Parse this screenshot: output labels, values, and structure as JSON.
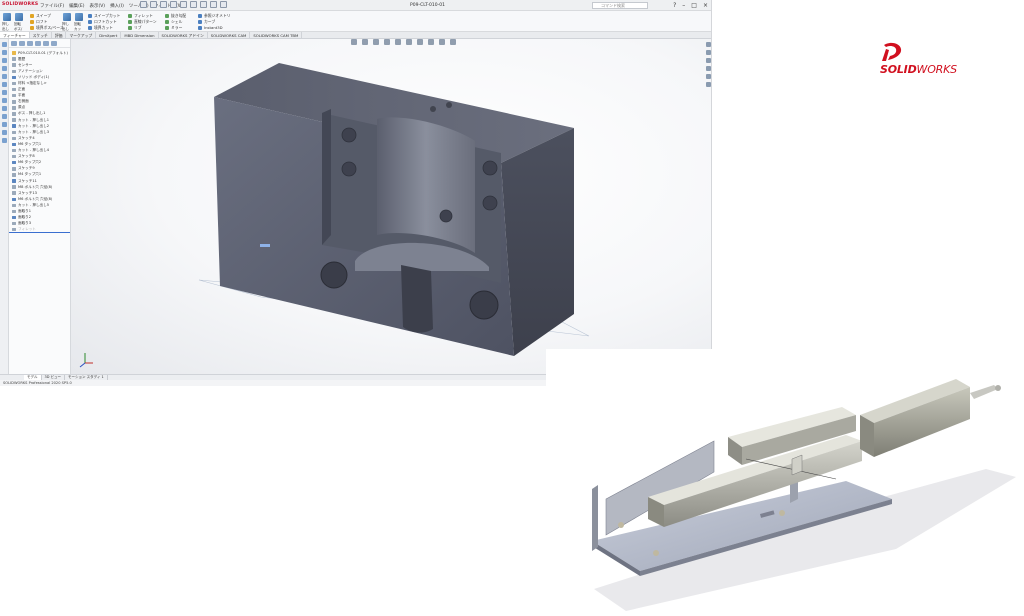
{
  "app": {
    "logo_text": "SOLIDWORKS",
    "document_title": "P09-CLT-010-01",
    "menus": [
      "ファイル(F)",
      "編集(E)",
      "表示(V)",
      "挿入(I)",
      "ツール(T)",
      "ウィンドウ(W)"
    ],
    "search_placeholder": "コマンド検索",
    "window_controls": [
      "?",
      "–",
      "□",
      "×"
    ]
  },
  "ribbon": {
    "groups": [
      {
        "items": [
          "押し出し ボス/ベース",
          "回転 ボス/ベース"
        ]
      },
      {
        "items": [
          "スイープ",
          "ロフト",
          "境界ボス/ベース"
        ]
      },
      {
        "items": [
          "押し出しカット",
          "回転カット"
        ]
      },
      {
        "items": [
          "スイープカット",
          "ロフトカット",
          "境界カット"
        ]
      },
      {
        "items": [
          "フィレット",
          "直線パターン",
          "リブ"
        ]
      },
      {
        "items": [
          "抜き勾配",
          "シェル",
          "ミラー"
        ]
      },
      {
        "items": [
          "参照ジオメトリ",
          "カーブ",
          "Instant3D"
        ]
      }
    ]
  },
  "command_tabs": [
    "フィーチャー",
    "スケッチ",
    "評価",
    "マークアップ",
    "DimXpert",
    "MBD Dimension",
    "SOLIDWORKS アドイン",
    "SOLIDWORKS CAM",
    "SOLIDWORKS CAM TBM"
  ],
  "feature_tree": [
    "P09-CLT-010-01 (デフォルト)",
    "履歴",
    "センサー",
    "アノテーション",
    "ソリッド ボディ(1)",
    "材料 <指定なし>",
    "正面",
    "平面",
    "右側面",
    "原点",
    "ボス - 押し出し1",
    "カット - 押し出し1",
    "カット - 押し出し2",
    "カット - 押し出し3",
    "スケッチ4",
    "M6 タップ穴1",
    "カット - 押し出し4",
    "スケッチ8",
    "M6 タップ穴2",
    "スケッチ9",
    "M4 タップ穴1",
    "スケッチ11",
    "M8 ボルト穴 穴径(8)",
    "スケッチ13",
    "M6 ボルト穴 穴径(8)",
    "カット - 押し出し5",
    "面取り1",
    "面取り2",
    "面取り3",
    "フィレット"
  ],
  "bottom_tabs": [
    "モデル",
    "3D ビュー",
    "モーション スタディ 1"
  ],
  "status_text": "SOLIDWORKS Professional 2020 SP5.0",
  "brand": {
    "name_bold": "SOLID",
    "name_light": "WORKS",
    "color": "#d1101f"
  }
}
